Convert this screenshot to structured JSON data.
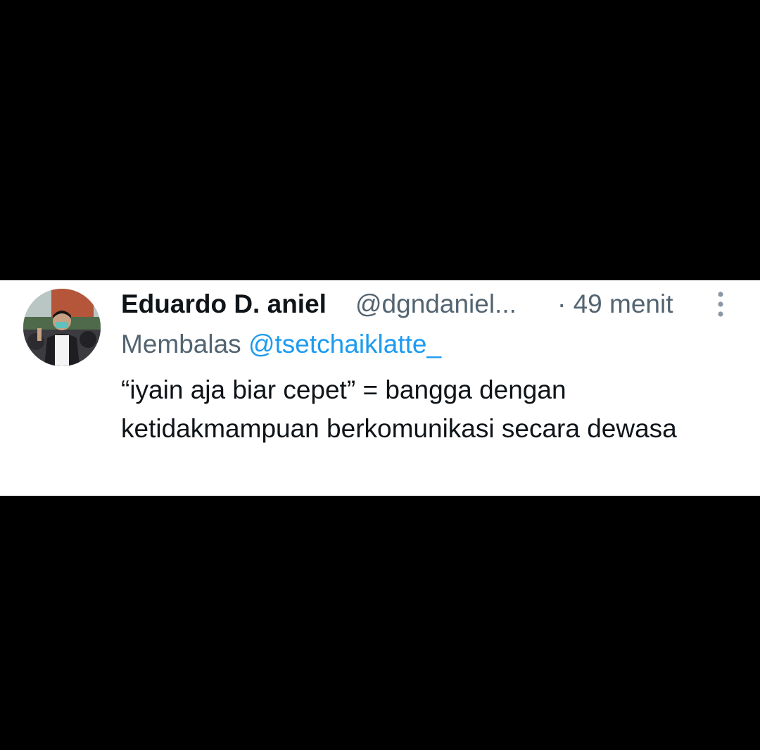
{
  "tweet": {
    "display_name": "Eduardo D. aniel",
    "handle": "@dgndaniel...",
    "time": "· 49 menit",
    "reply_prefix": "Membalas",
    "reply_mention": "@tsetchaiklatte_",
    "text": "“iyain aja biar cepet” = bangga dengan ketidakmampuan berkomunikasi secara dewasa",
    "more_icon": "vertical-ellipsis-icon"
  },
  "colors": {
    "background": "#000000",
    "card": "#ffffff",
    "primary_text": "#0f1419",
    "secondary_text": "#536471",
    "mention": "#1d9bf0"
  }
}
